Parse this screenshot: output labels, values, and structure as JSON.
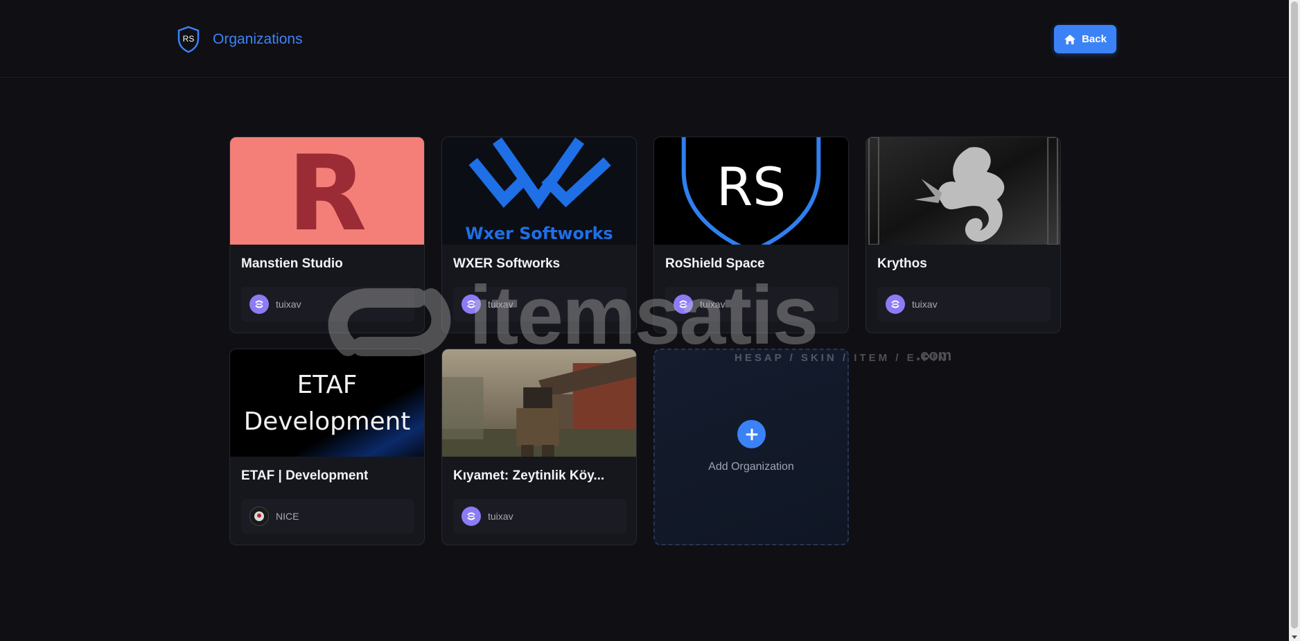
{
  "header": {
    "logo_text": "RS",
    "title": "Organizations",
    "back_label": "Back"
  },
  "organizations": [
    {
      "name": "Manstien Studio",
      "owner": "tuixav",
      "image_text": "R"
    },
    {
      "name": "WXER Softworks",
      "owner": "tuixav",
      "image_text": "Wxer Softworks"
    },
    {
      "name": "RoShield Space",
      "owner": "tuixav",
      "image_text": "RS"
    },
    {
      "name": "Krythos",
      "owner": "tuixav"
    },
    {
      "name": "ETAF | Development",
      "owner": "NICE",
      "image_text_line1": "ETAF",
      "image_text_line2": "Development"
    },
    {
      "name": "Kıyamet: Zeytinlik Köy...",
      "owner": "tuixav"
    }
  ],
  "add_card": {
    "label": "Add Organization"
  },
  "watermark": {
    "word": "itemsatis",
    "sub": "HESAP / SKIN / ITEM / E-PIN",
    "domain": ".com"
  },
  "colors": {
    "accent": "#3b82f6",
    "background": "#0f0f14",
    "card": "#16171d",
    "manstien_bg": "#f47f78"
  }
}
